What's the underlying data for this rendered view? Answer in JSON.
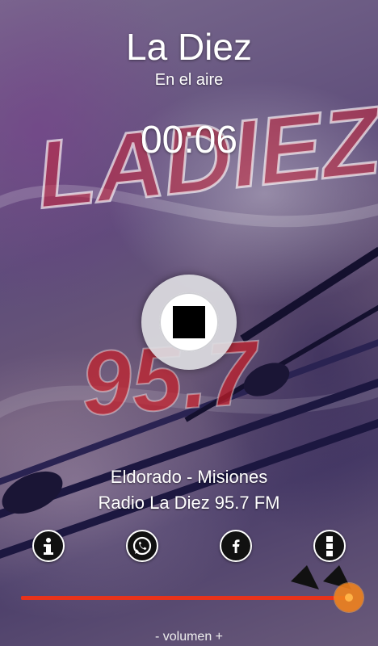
{
  "header": {
    "title": "La Diez",
    "status": "En el aire",
    "elapsed": "00:06"
  },
  "background": {
    "logo_text": "LADIEZ",
    "frequency_text": "95.7"
  },
  "player": {
    "state": "playing",
    "control_icon": "stop-icon"
  },
  "info": {
    "location": "Eldorado - Misiones",
    "station": "Radio La Diez 95.7 FM"
  },
  "actions": [
    {
      "name": "info",
      "icon": "info-icon"
    },
    {
      "name": "whatsapp",
      "icon": "whatsapp-icon"
    },
    {
      "name": "facebook",
      "icon": "facebook-icon"
    },
    {
      "name": "menu",
      "icon": "more-vertical-icon"
    }
  ],
  "volume": {
    "label": "- volumen +",
    "level": 1.0
  },
  "colors": {
    "accent": "#e8331b",
    "thumb": "#f0821e"
  }
}
